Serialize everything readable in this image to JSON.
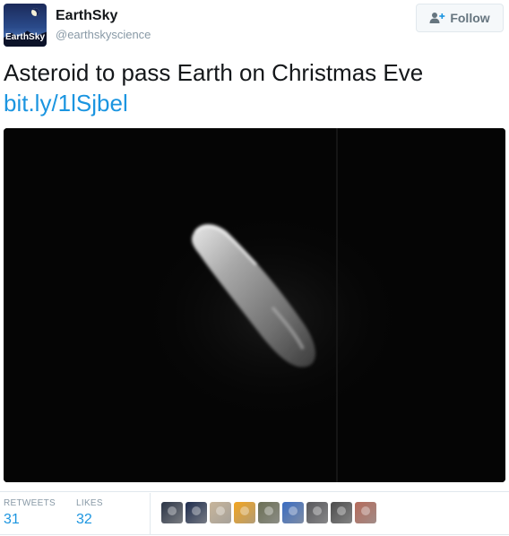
{
  "account": {
    "display_name": "EarthSky",
    "handle": "@earthskyscience",
    "avatar_text": "EarthSky"
  },
  "follow_button": {
    "label": "Follow"
  },
  "tweet": {
    "text": "Asteroid to pass Earth on Christmas Eve",
    "link": "bit.ly/1lSjbel"
  },
  "stats": {
    "retweets": {
      "label": "RETWEETS",
      "value": "31"
    },
    "likes": {
      "label": "LIKES",
      "value": "32"
    }
  },
  "likers": [
    {
      "icon": "liker-avatar",
      "color": "#2b3446"
    },
    {
      "icon": "liker-avatar",
      "color": "#1e2c4d"
    },
    {
      "icon": "liker-avatar",
      "color": "#c7b59a"
    },
    {
      "icon": "liker-avatar",
      "color": "#f3a51f"
    },
    {
      "icon": "liker-avatar",
      "color": "#6b6f55"
    },
    {
      "icon": "liker-avatar",
      "color": "#3a6cc2"
    },
    {
      "icon": "liker-avatar",
      "color": "#58585c"
    },
    {
      "icon": "liker-avatar",
      "color": "#4c4c4c"
    },
    {
      "icon": "liker-avatar",
      "color": "#b56a5a"
    }
  ],
  "colors": {
    "link": "#1b95e0",
    "muted": "#8899a6",
    "border": "#e1e8ed"
  }
}
